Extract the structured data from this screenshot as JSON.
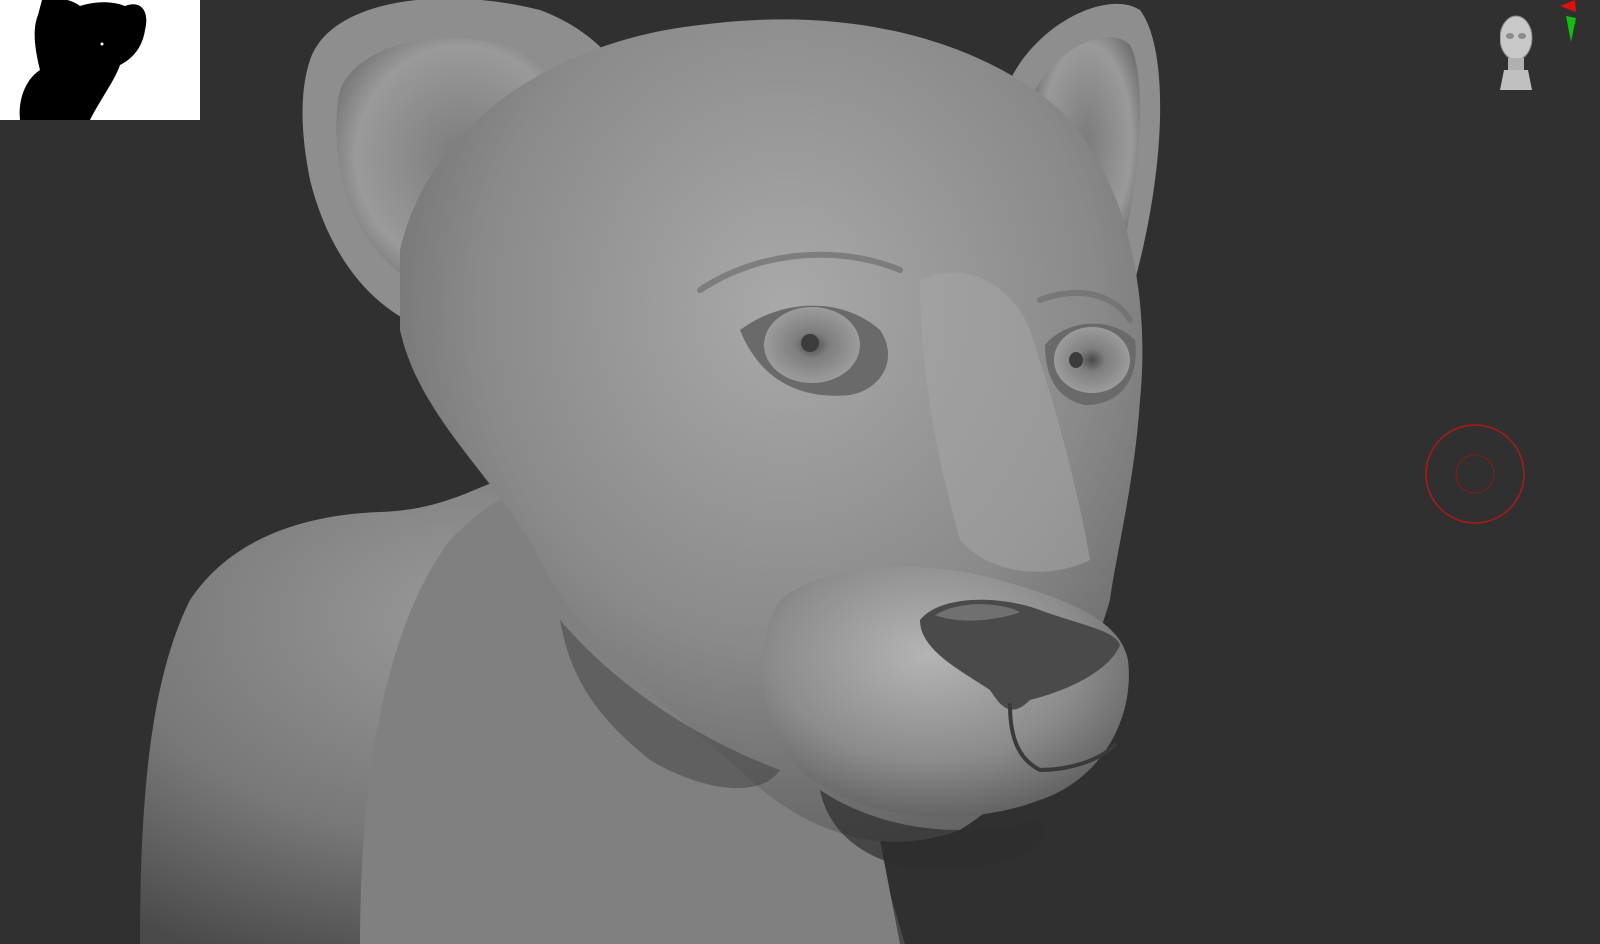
{
  "app": {
    "type": "3d-sculpting-viewport"
  },
  "viewport": {
    "background_color": "#303030",
    "model": {
      "subject": "lion-cub-sculpt",
      "material_color": "#8a8a8a",
      "shading": "matcap-gray"
    }
  },
  "navigator": {
    "background_color": "#ffffff",
    "silhouette_color": "#000000"
  },
  "axis_widget": {
    "icon": "head-orientation-icon",
    "axis_colors": {
      "x": "#e01010",
      "y": "#10c010"
    }
  },
  "brush_cursor": {
    "color": "#b01818"
  }
}
